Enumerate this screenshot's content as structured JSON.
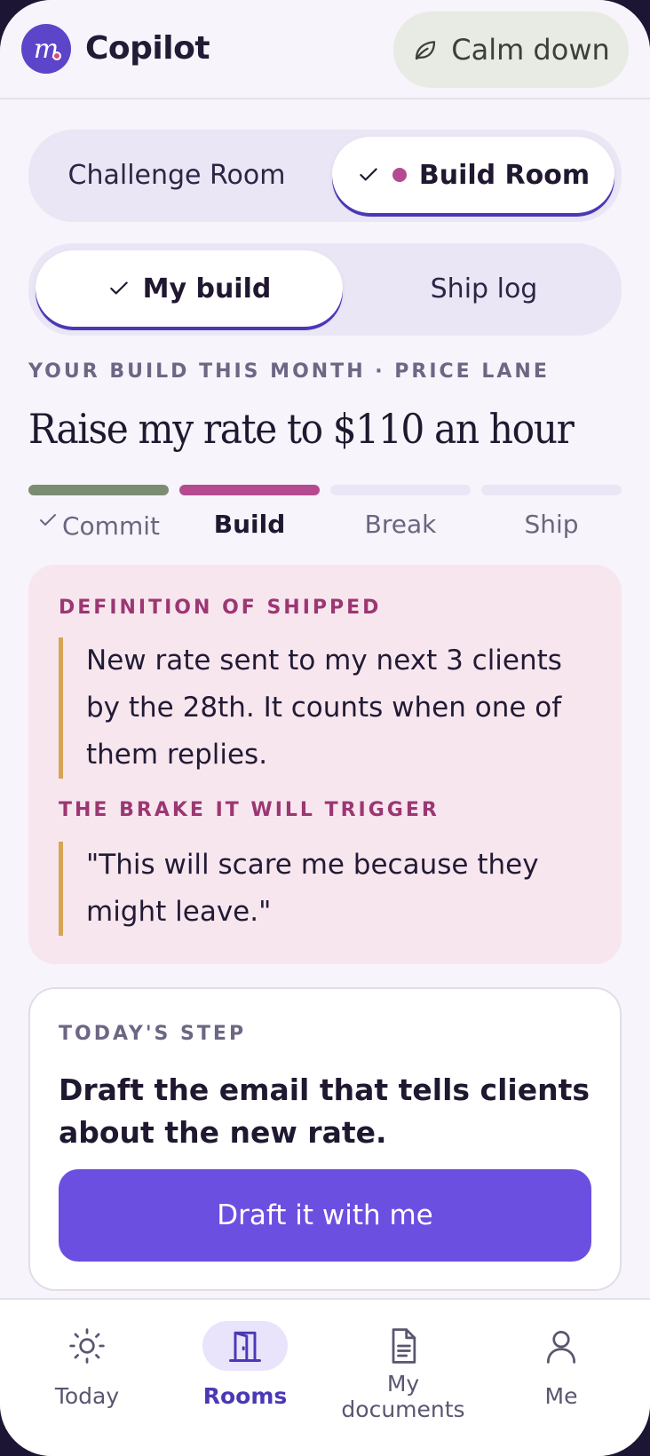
{
  "header": {
    "app_title": "Copilot",
    "logo_glyph": "m",
    "calm_button_label": "Calm down",
    "calm_icon": "leaf-icon"
  },
  "room_switch": {
    "items": [
      {
        "label": "Challenge Room",
        "active": false
      },
      {
        "label": "Build Room",
        "active": true
      }
    ]
  },
  "build_switch": {
    "items": [
      {
        "label": "My build",
        "active": true
      },
      {
        "label": "Ship log",
        "active": false
      }
    ]
  },
  "build": {
    "eyebrow": "YOUR BUILD THIS MONTH · PRICE LANE",
    "goal": "Raise my rate to $110 an hour",
    "stages": [
      {
        "label": "Commit",
        "state": "done"
      },
      {
        "label": "Build",
        "state": "current"
      },
      {
        "label": "Break",
        "state": "todo"
      },
      {
        "label": "Ship",
        "state": "todo"
      }
    ]
  },
  "definition_card": {
    "shipped_title": "DEFINITION OF SHIPPED",
    "shipped_text_lines": [
      "New rate sent to my next 3 clients",
      "by the 28th. It counts when one of",
      "them replies."
    ],
    "brake_title": "THE BRAKE IT WILL TRIGGER",
    "brake_text_lines": [
      "\"This will scare me because they",
      "might leave.\""
    ]
  },
  "step_card": {
    "eyebrow": "TODAY'S STEP",
    "title_lines": [
      "Draft the email that tells clients",
      "about the new rate."
    ],
    "button_label": "Draft it with me"
  },
  "bottom_nav": {
    "items": [
      {
        "label": "Today",
        "icon": "sun-icon",
        "active": false
      },
      {
        "label": "Rooms",
        "icon": "door-icon",
        "active": true
      },
      {
        "label_lines": [
          "My",
          "documents"
        ],
        "icon": "document-icon",
        "active": false
      },
      {
        "label": "Me",
        "icon": "person-icon",
        "active": false
      }
    ]
  },
  "colors": {
    "accent": "#6b4fe0",
    "brand": "#5d45c9",
    "done": "#7c8c72",
    "current": "#b54a91",
    "todo": "#ebe6f5"
  }
}
